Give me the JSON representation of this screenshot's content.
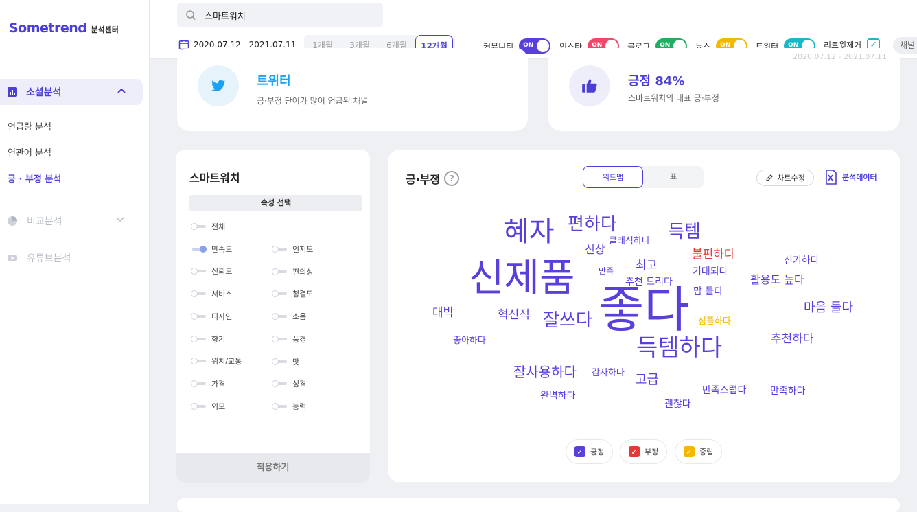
{
  "sidebar": {
    "brand": "Sometrend",
    "brand_sub": "분석센터",
    "active_section": "소셜분석",
    "sub_items": [
      "언급량 분석",
      "연관어 분석",
      "긍 · 부정 분석"
    ],
    "sections": [
      "비교분석",
      "유튜브분석"
    ]
  },
  "search": {
    "query": "스마트워치"
  },
  "filter": {
    "date_range": "2020.07.12 - 2021.07.11",
    "periods": [
      "1개월",
      "3개월",
      "6개월",
      "12개월"
    ],
    "selected_period": "12개월",
    "channels": [
      {
        "label": "커뮤니티",
        "state": "ON",
        "color": "#5b3fdc"
      },
      {
        "label": "인스타",
        "state": "ON",
        "color": "#f2476a"
      },
      {
        "label": "블로그",
        "state": "ON",
        "color": "#1fae62"
      },
      {
        "label": "뉴스",
        "state": "ON",
        "color": "#f5b800"
      },
      {
        "label": "트위터",
        "state": "ON",
        "color": "#19b8c7"
      }
    ],
    "retweet_label": "리트윗제거",
    "chip": "채널"
  },
  "card_left": {
    "title": "트위터",
    "desc": "긍·부정 단어가 많이 언급된 채널"
  },
  "card_right": {
    "title": "긍정 84%",
    "desc": "스마트워치의 대표 긍·부정",
    "overlap_text": "2020.07.12 - 2021.07.11"
  },
  "attr_panel": {
    "title": "스마트워치",
    "head": "속성 선택",
    "left_col": [
      {
        "label": "전체",
        "on": false
      },
      {
        "label": "만족도",
        "on": true
      },
      {
        "label": "신뢰도",
        "on": false
      },
      {
        "label": "서비스",
        "on": false
      },
      {
        "label": "디자인",
        "on": false
      },
      {
        "label": "향기",
        "on": false
      },
      {
        "label": "위치/교통",
        "on": false
      },
      {
        "label": "가격",
        "on": false
      },
      {
        "label": "외모",
        "on": false
      }
    ],
    "right_col": [
      {
        "label": "인지도",
        "on": false
      },
      {
        "label": "편의성",
        "on": false
      },
      {
        "label": "청결도",
        "on": false
      },
      {
        "label": "소음",
        "on": false
      },
      {
        "label": "풍경",
        "on": false
      },
      {
        "label": "맛",
        "on": false
      },
      {
        "label": "성격",
        "on": false
      },
      {
        "label": "능력",
        "on": false
      }
    ],
    "apply": "적용하기"
  },
  "wordmap": {
    "title": "긍·부정",
    "help": "?",
    "tabs": [
      "워드맵",
      "표"
    ],
    "edit_btn": "차트수정",
    "data_btn": "분석데이터",
    "colors": {
      "positive": "#5b3fdc",
      "negative": "#e53935",
      "neutral": "#f5b800"
    },
    "words": [
      {
        "text": "신제품",
        "sentiment": "positive"
      },
      {
        "text": "좋다",
        "sentiment": "positive"
      },
      {
        "text": "혜자",
        "sentiment": "positive"
      },
      {
        "text": "편하다",
        "sentiment": "positive"
      },
      {
        "text": "득템",
        "sentiment": "positive"
      },
      {
        "text": "득템하다",
        "sentiment": "positive"
      },
      {
        "text": "잘쓰다",
        "sentiment": "positive"
      },
      {
        "text": "잘사용하다",
        "sentiment": "positive"
      },
      {
        "text": "마음 들다",
        "sentiment": "positive"
      },
      {
        "text": "활용도 높다",
        "sentiment": "positive"
      },
      {
        "text": "불편하다",
        "sentiment": "negative"
      },
      {
        "text": "추천하다",
        "sentiment": "positive"
      },
      {
        "text": "신상",
        "sentiment": "positive"
      },
      {
        "text": "클래식하다",
        "sentiment": "positive"
      },
      {
        "text": "최고",
        "sentiment": "positive"
      },
      {
        "text": "기대되다",
        "sentiment": "positive"
      },
      {
        "text": "신기하다",
        "sentiment": "positive"
      },
      {
        "text": "만족",
        "sentiment": "positive"
      },
      {
        "text": "추천 드리다",
        "sentiment": "positive"
      },
      {
        "text": "맘 들다",
        "sentiment": "positive"
      },
      {
        "text": "대박",
        "sentiment": "positive"
      },
      {
        "text": "혁신적",
        "sentiment": "positive"
      },
      {
        "text": "심플하다",
        "sentiment": "neutral"
      },
      {
        "text": "좋아하다",
        "sentiment": "positive"
      },
      {
        "text": "감사하다",
        "sentiment": "positive"
      },
      {
        "text": "고급",
        "sentiment": "positive"
      },
      {
        "text": "완벽하다",
        "sentiment": "positive"
      },
      {
        "text": "만족스럽다",
        "sentiment": "positive"
      },
      {
        "text": "만족하다",
        "sentiment": "positive"
      },
      {
        "text": "괜찮다",
        "sentiment": "positive"
      }
    ],
    "legend": [
      "긍정",
      "부정",
      "중립"
    ]
  }
}
